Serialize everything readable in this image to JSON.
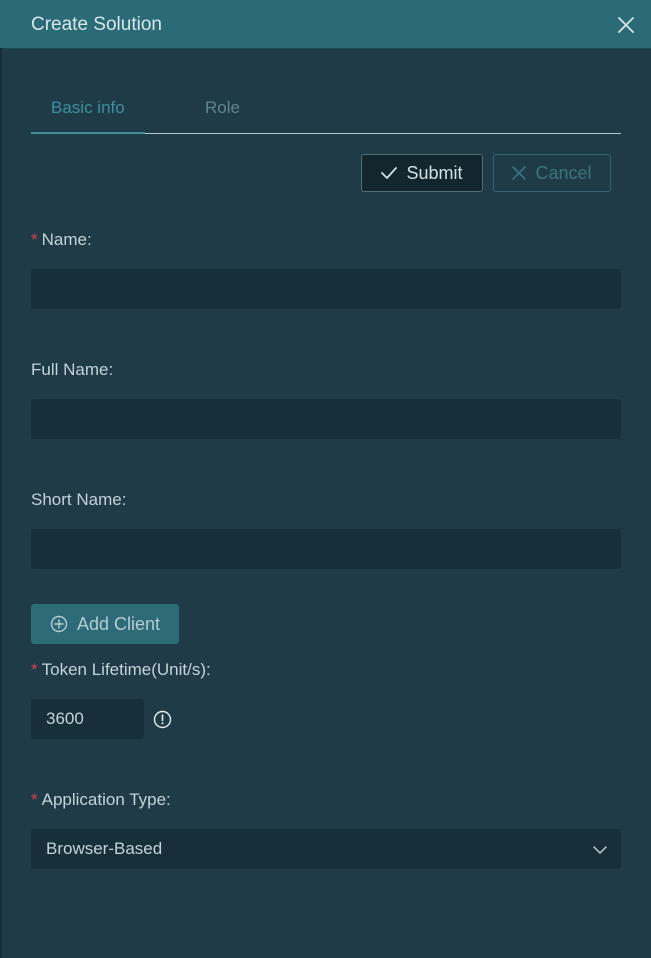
{
  "dialog": {
    "title": "Create Solution"
  },
  "tabs": [
    {
      "label": "Basic info",
      "active": true
    },
    {
      "label": "Role",
      "active": false
    }
  ],
  "actions": {
    "submit_label": "Submit",
    "cancel_label": "Cancel"
  },
  "form": {
    "name": {
      "label": "Name:",
      "required": true,
      "value": ""
    },
    "full_name": {
      "label": "Full Name:",
      "required": false,
      "value": ""
    },
    "short_name": {
      "label": "Short Name:",
      "required": false,
      "value": ""
    },
    "add_client_label": "Add Client",
    "token_lifetime": {
      "label": "Token Lifetime(Unit/s):",
      "required": true,
      "value": "3600"
    },
    "application_type": {
      "label": "Application Type:",
      "required": true,
      "value": "Browser-Based"
    }
  },
  "icons": {
    "close": "close-icon",
    "submit": "check-icon",
    "cancel": "x-icon",
    "add_client": "plus-circle-icon",
    "token_info": "info-icon",
    "select": "chevron-down-icon"
  },
  "colors": {
    "header": "#2b6b78",
    "background": "#1f3b47",
    "accent": "#3e8f9d",
    "required": "#e0394f"
  }
}
